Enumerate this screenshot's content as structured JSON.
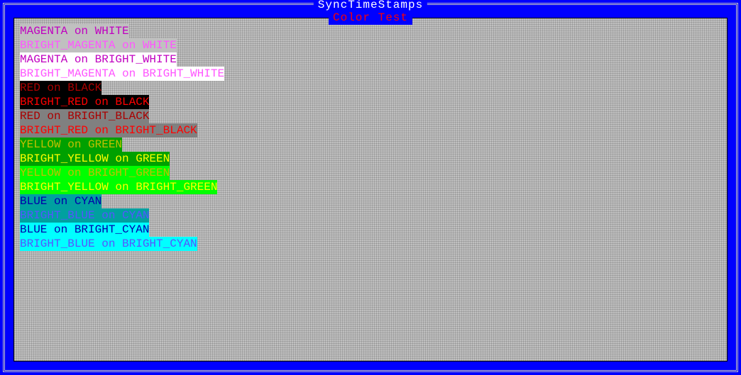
{
  "app_title": " SyncTimeStamps ",
  "panel_title": " Color Test ",
  "colors": {
    "WHITE": "#c0c0c0",
    "BRIGHT_WHITE": "#ffffff",
    "BLACK": "#000000",
    "BRIGHT_BLACK": "#808080",
    "GREEN": "#00a000",
    "BRIGHT_GREEN": "#00ff00",
    "CYAN": "#00a0a0",
    "BRIGHT_CYAN": "#00ffff",
    "MAGENTA": "#c000c0",
    "BRIGHT_MAGENTA": "#ff55ff",
    "RED": "#aa0000",
    "BRIGHT_RED": "#ff0000",
    "YELLOW": "#c0c000",
    "BRIGHT_YELLOW": "#ffff00",
    "BLUE": "#0000aa",
    "BRIGHT_BLUE": "#5555ff"
  },
  "lines": [
    {
      "text": "MAGENTA on WHITE",
      "fg": "MAGENTA",
      "bg": "WHITE"
    },
    {
      "text": "BRIGHT_MAGENTA on WHITE",
      "fg": "BRIGHT_MAGENTA",
      "bg": "WHITE"
    },
    {
      "text": "MAGENTA on BRIGHT_WHITE",
      "fg": "MAGENTA",
      "bg": "BRIGHT_WHITE"
    },
    {
      "text": "BRIGHT_MAGENTA on BRIGHT_WHITE",
      "fg": "BRIGHT_MAGENTA",
      "bg": "BRIGHT_WHITE"
    },
    {
      "text": "RED on BLACK",
      "fg": "RED",
      "bg": "BLACK"
    },
    {
      "text": "BRIGHT_RED on BLACK",
      "fg": "BRIGHT_RED",
      "bg": "BLACK"
    },
    {
      "text": "RED on BRIGHT_BLACK",
      "fg": "RED",
      "bg": "BRIGHT_BLACK"
    },
    {
      "text": "BRIGHT_RED on BRIGHT_BLACK",
      "fg": "BRIGHT_RED",
      "bg": "BRIGHT_BLACK"
    },
    {
      "text": "YELLOW on GREEN",
      "fg": "YELLOW",
      "bg": "GREEN"
    },
    {
      "text": "BRIGHT_YELLOW on GREEN",
      "fg": "BRIGHT_YELLOW",
      "bg": "GREEN"
    },
    {
      "text": "YELLOW on BRIGHT_GREEN",
      "fg": "YELLOW",
      "bg": "BRIGHT_GREEN"
    },
    {
      "text": "BRIGHT_YELLOW on BRIGHT_GREEN",
      "fg": "BRIGHT_YELLOW",
      "bg": "BRIGHT_GREEN"
    },
    {
      "text": "BLUE on CYAN",
      "fg": "BLUE",
      "bg": "CYAN"
    },
    {
      "text": "BRIGHT_BLUE on CYAN",
      "fg": "BRIGHT_BLUE",
      "bg": "CYAN"
    },
    {
      "text": "BLUE on BRIGHT_CYAN",
      "fg": "BLUE",
      "bg": "BRIGHT_CYAN"
    },
    {
      "text": "BRIGHT_BLUE on BRIGHT_CYAN",
      "fg": "BRIGHT_BLUE",
      "bg": "BRIGHT_CYAN"
    }
  ]
}
